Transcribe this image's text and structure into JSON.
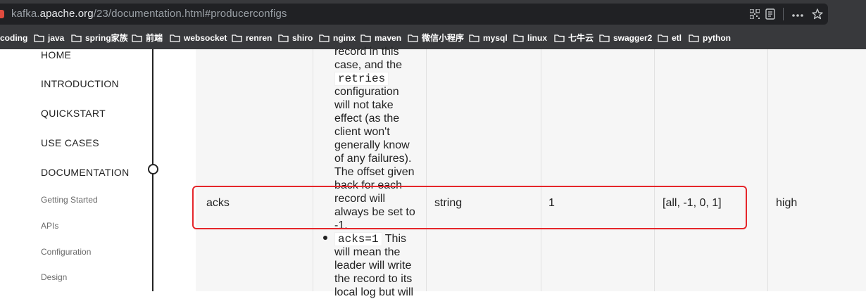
{
  "browser": {
    "url_host_prefix": "kafka.",
    "url_host": "apache.org",
    "url_path": "/23/documentation.html#producerconfigs",
    "bookmarks": [
      "coding",
      "java",
      "spring家族",
      "前端",
      "websocket",
      "renren",
      "shiro",
      "nginx",
      "maven",
      "微信小程序",
      "mysql",
      "linux",
      "七牛云",
      "swagger2",
      "etl",
      "python"
    ]
  },
  "sidebar": {
    "items": [
      "HOME",
      "INTRODUCTION",
      "QUICKSTART",
      "USE CASES",
      "DOCUMENTATION"
    ],
    "subitems": [
      "Getting Started",
      "APIs",
      "Configuration",
      "Design"
    ]
  },
  "row": {
    "name": "acks",
    "type": "string",
    "default": "1",
    "valid_values": "[all, -1, 0, 1]",
    "importance": "high"
  },
  "description": {
    "line_1": "record in this",
    "line_2": "case, and the",
    "code_retries": "retries",
    "line_4": "configuration",
    "line_5": "will not take",
    "line_6": "effect (as the",
    "line_7": "client won't",
    "line_8": "generally know",
    "line_9": "of any failures).",
    "line_10": "The offset given",
    "line_11": "back for each",
    "line_12": "record will",
    "line_13": "always be set to",
    "line_14": "-1.",
    "code_acks1": "acks=1",
    "bullet_tail": "This",
    "line_16": "will mean the",
    "line_17": "leader will write",
    "line_18": "the record to its",
    "line_19": "local log but will"
  }
}
